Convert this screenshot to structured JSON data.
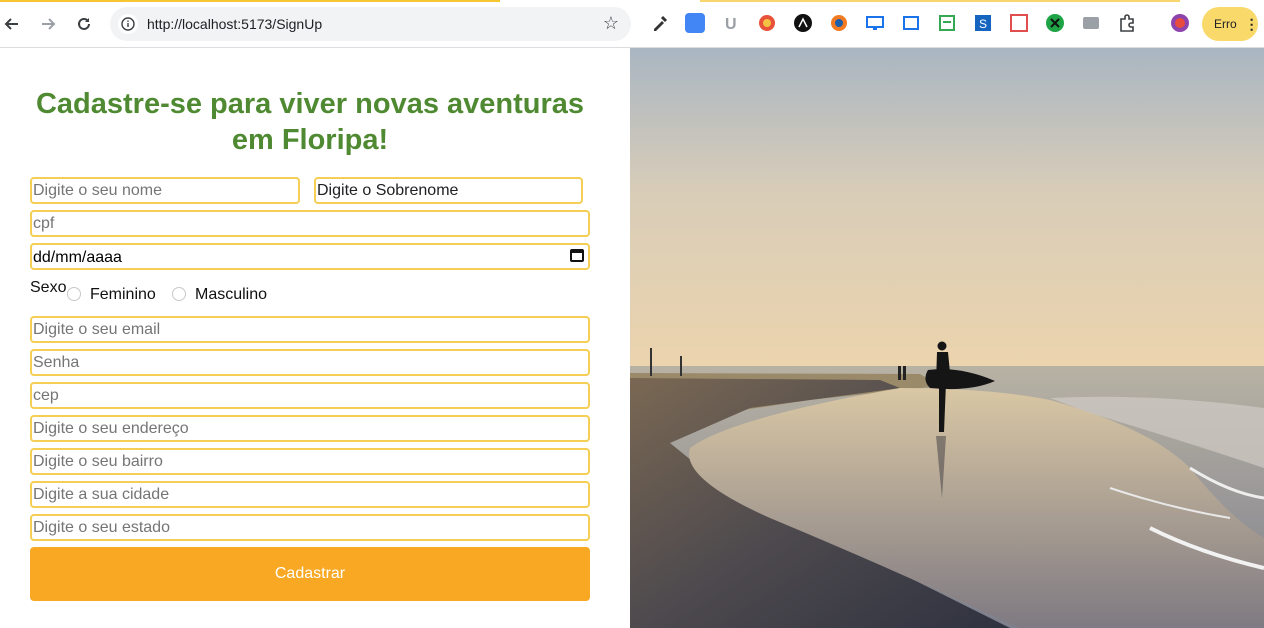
{
  "browser": {
    "url": "http://localhost:5173/SignUp",
    "profile_label": "Erro",
    "accent": "#f7c531"
  },
  "form": {
    "title": "Cadastre-se para viver novas aventuras em Floripa!",
    "first_name_placeholder": "Digite o seu nome",
    "last_name_value": "Digite o Sobrenome",
    "cpf_placeholder": "cpf",
    "birthdate_value": "dd/mm/aaaa",
    "sex_label": "Sexo",
    "sex_options": [
      "Feminino",
      "Masculino"
    ],
    "email_placeholder": "Digite o seu email",
    "password_placeholder": "Senha",
    "cep_placeholder": "cep",
    "address_placeholder": "Digite o seu endereço",
    "neighborhood_placeholder": "Digite o seu bairro",
    "city_placeholder": "Digite a sua cidade",
    "state_placeholder": "Digite o seu estado",
    "submit_label": "Cadastrar",
    "colors": {
      "title": "#4f8a32",
      "field_border": "#f5cf55",
      "button": "#f8a823"
    }
  },
  "hero_image": {
    "icon": "beach-surfer-photo"
  }
}
